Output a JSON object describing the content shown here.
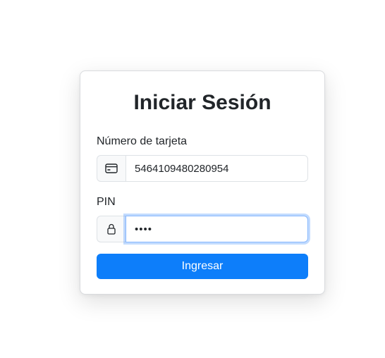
{
  "login": {
    "title": "Iniciar Sesión",
    "card_number": {
      "label": "Número de tarjeta",
      "value": "5464109480280954",
      "icon": "credit-card-icon"
    },
    "pin": {
      "label": "PIN",
      "masked_value": "••••",
      "icon": "lock-icon"
    },
    "submit_label": "Ingresar"
  },
  "colors": {
    "primary_button": "#0d7efa",
    "focus_border": "#86b7fe",
    "addon_background": "#f8f9fa",
    "text": "#212529"
  }
}
